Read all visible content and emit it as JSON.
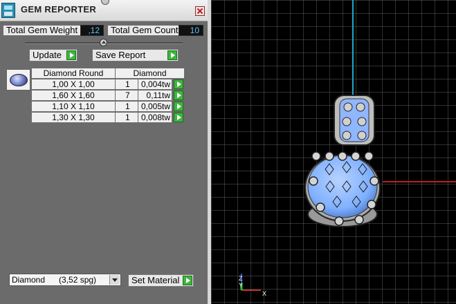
{
  "window": {
    "title": "GEM REPORTER"
  },
  "summary": {
    "total_weight_label": "Total Gem Weight",
    "total_weight_value": ",12",
    "total_count_label": "Total Gem Count",
    "total_count_value": "10"
  },
  "actions": {
    "update_label": "Update",
    "save_report_label": "Save Report"
  },
  "table": {
    "headers": [
      "Diamond Round",
      "Diamond"
    ],
    "rows": [
      {
        "size": "1,00 X 1,00",
        "count": "1",
        "weight": "0,004tw"
      },
      {
        "size": "1,60 X 1,60",
        "count": "7",
        "weight": "0,11tw"
      },
      {
        "size": "1,10 X 1,10",
        "count": "1",
        "weight": "0,005tw"
      },
      {
        "size": "1,30 X 1,30",
        "count": "1",
        "weight": "0,008tw"
      }
    ]
  },
  "material": {
    "selected": "Diamond      (3,52 spg)",
    "set_label": "Set Material"
  },
  "viewport": {
    "axis_labels": {
      "z": "Z",
      "y": "Y",
      "x": "X"
    }
  },
  "colors": {
    "accent_value": "#5cc8ff",
    "play_button": "#3eb63e",
    "grid": "#6b6b6b",
    "y_axis": "#1fa9c9",
    "x_axis": "#c01f1f",
    "gem": "#7fb0ff",
    "metal": "#bdbdbd"
  },
  "icons": [
    "app-logo-icon",
    "close-icon",
    "collapse-knob-icon",
    "play-arrow-icon",
    "gem-thumbnail-icon",
    "dropdown-arrow-icon",
    "axis-gizmo-icon"
  ]
}
